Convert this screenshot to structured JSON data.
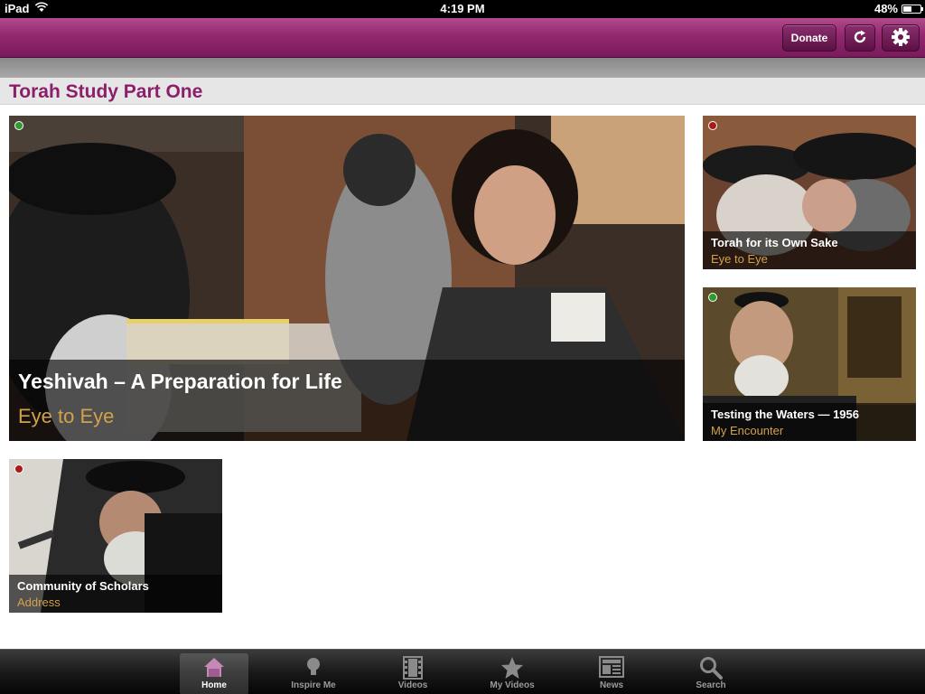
{
  "status_bar": {
    "device": "iPad",
    "time": "4:19 PM",
    "battery": "48%",
    "battery_level": 0.48
  },
  "nav": {
    "donate_label": "Donate",
    "refresh_icon": "refresh-icon",
    "settings_icon": "gear-icon"
  },
  "page": {
    "title": "Torah Study Part One"
  },
  "tiles": [
    {
      "title": "Yeshivah – A Preparation for Life",
      "subtitle": "Eye to Eye",
      "status": "green"
    },
    {
      "title": "Torah for its Own Sake",
      "subtitle": "Eye to Eye",
      "status": "red"
    },
    {
      "title": "Testing the Waters — 1956",
      "subtitle": "My Encounter",
      "status": "green"
    },
    {
      "title": "Community of Scholars",
      "subtitle": "Address",
      "status": "red"
    }
  ],
  "tabs": [
    {
      "label": "Home",
      "icon": "home-icon",
      "active": true
    },
    {
      "label": "Inspire Me",
      "icon": "lightbulb-icon",
      "active": false
    },
    {
      "label": "Videos",
      "icon": "film-icon",
      "active": false
    },
    {
      "label": "My Videos",
      "icon": "star-icon",
      "active": false
    },
    {
      "label": "News",
      "icon": "newspaper-icon",
      "active": false
    },
    {
      "label": "Search",
      "icon": "search-icon",
      "active": false
    }
  ],
  "colors": {
    "accent": "#8b1f69",
    "nav_bar": "#92286f",
    "subtitle": "#d2a24b",
    "status_green": "#2c9c2c",
    "status_red": "#b01818"
  }
}
